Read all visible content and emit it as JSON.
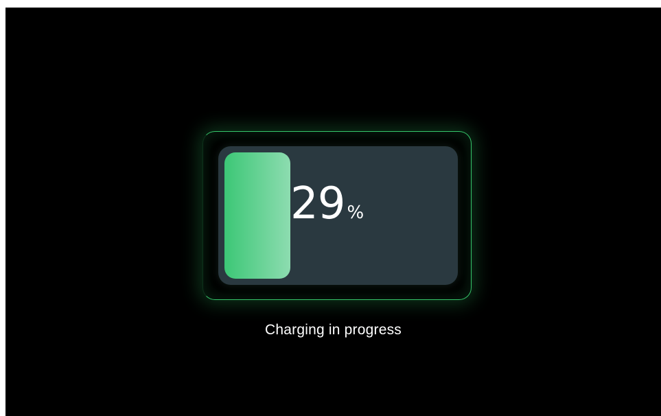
{
  "battery": {
    "level_percent": 29,
    "value_text": "29",
    "unit_text": "%",
    "fill_color_start": "#3cc776",
    "fill_color_end": "#8ddcb0",
    "body_color": "#2a3940",
    "glow_color": "#36c76b"
  },
  "status": {
    "label": "Charging in progress"
  },
  "colors": {
    "background": "#000000",
    "text": "#ffffff"
  }
}
